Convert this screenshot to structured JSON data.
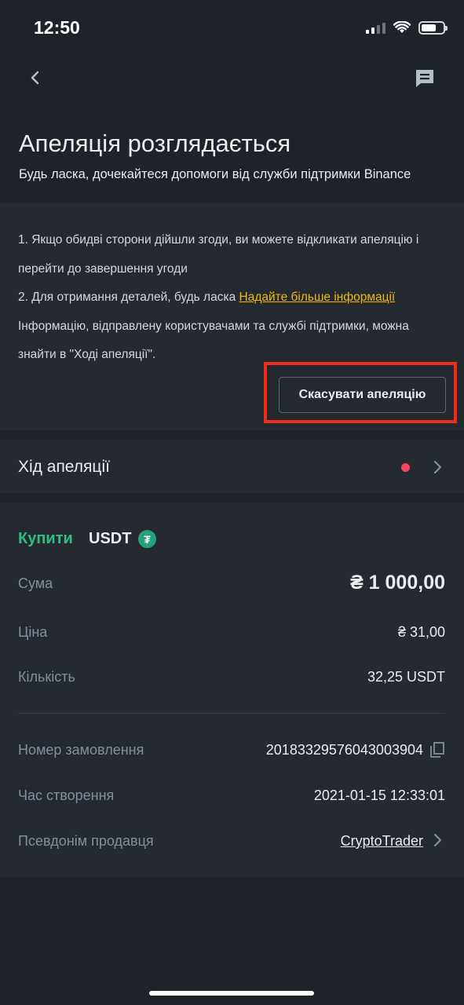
{
  "status_bar": {
    "time": "12:50"
  },
  "header": {
    "title": "Апеляція розглядається",
    "subtitle": "Будь ласка, дочекайтеся допомоги від служби підтримки Binance"
  },
  "info": {
    "line1": "1. Якщо обидві сторони дійшли згоди, ви можете відкликати апеляцію і перейти до завершення угоди",
    "line2_prefix": "2. Для отримання деталей, будь ласка ",
    "line2_link": "Надайте більше інформації",
    "line3": "Інформацію, відправлену користувачами та службі підтримки, можна знайти в \"Ході апеляції\".",
    "cancel_button": "Скасувати апеляцію"
  },
  "progress": {
    "label": "Хід апеляції"
  },
  "order": {
    "side": "Купити",
    "asset": "USDT",
    "asset_icon": "₮",
    "rows": [
      {
        "label": "Сума",
        "value": "₴ 1 000,00"
      },
      {
        "label": "Ціна",
        "value": "₴ 31,00"
      },
      {
        "label": "Кількість",
        "value": "32,25 USDT"
      },
      {
        "label": "Номер замовлення",
        "value": "20183329576043003904"
      },
      {
        "label": "Час створення",
        "value": "2021-01-15 12:33:01"
      },
      {
        "label": "Псевдонім продавця",
        "value": "CryptoTrader"
      }
    ]
  },
  "colors": {
    "background": "#1e2329",
    "card": "#252a31",
    "buy_green": "#2ebd85",
    "link_yellow": "#f0b90b",
    "alert_red": "#f6465d",
    "highlight_red": "#ef2d1a"
  }
}
